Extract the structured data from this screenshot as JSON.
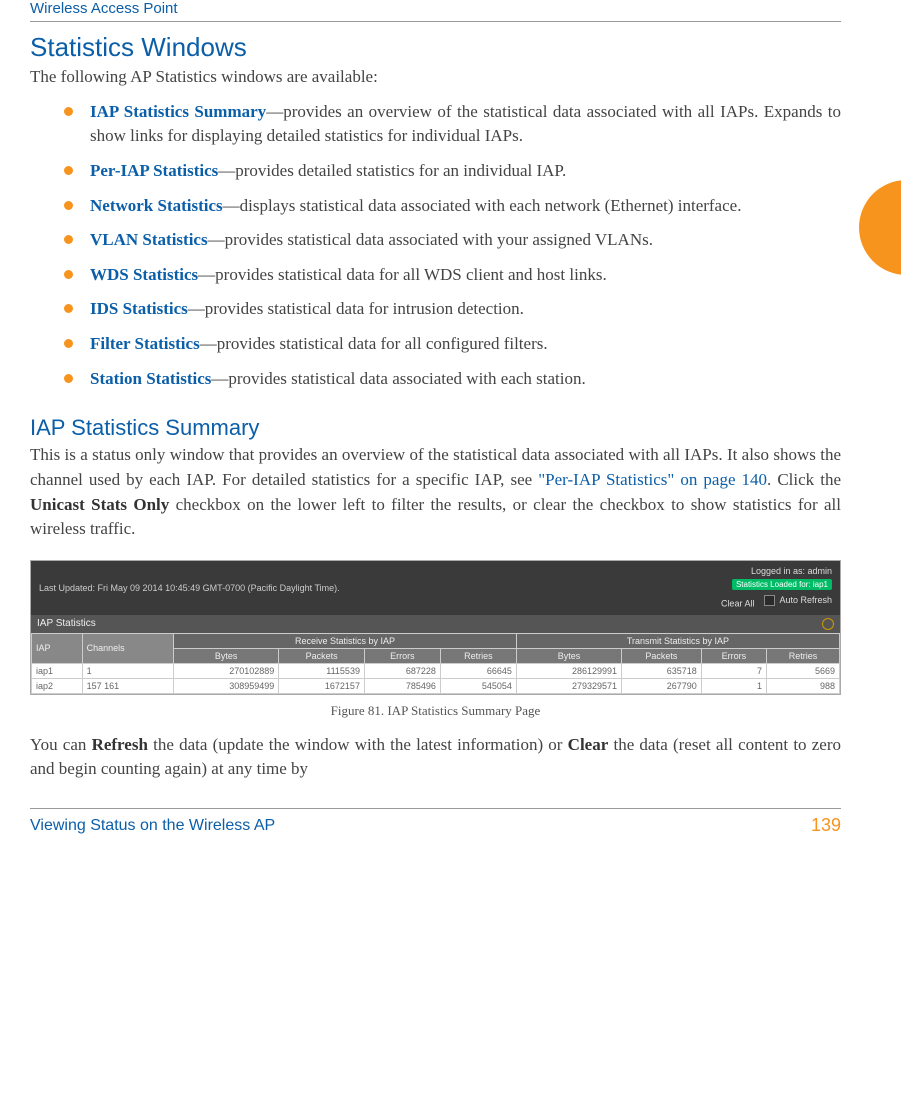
{
  "header": {
    "product": "Wireless Access Point"
  },
  "section_title": "Statistics Windows",
  "intro": "The following AP Statistics windows are available:",
  "bullets": [
    {
      "term": "IAP Statistics Summary",
      "rest": "—provides an overview of the statistical data associated with all IAPs. Expands to show links for displaying detailed statistics for individual IAPs."
    },
    {
      "term": "Per-IAP Statistics",
      "rest": "—provides detailed statistics for an individual IAP."
    },
    {
      "term": "Network Statistics",
      "rest": "—displays statistical data associated with each network (Ethernet) interface."
    },
    {
      "term": "VLAN Statistics",
      "rest": "—provides statistical data associated with your assigned VLANs."
    },
    {
      "term": "WDS Statistics",
      "rest": "—provides statistical data for all WDS client and host links."
    },
    {
      "term": "IDS Statistics",
      "rest": "—provides statistical data for intrusion detection."
    },
    {
      "term": "Filter Statistics",
      "rest": "—provides statistical data for all configured filters."
    },
    {
      "term": "Station Statistics",
      "rest": "—provides statistical data associated with each station."
    }
  ],
  "subsection_title": "IAP Statistics Summary",
  "para2_a": "This is a status only window that provides an overview of the statistical data associated with all IAPs. It also shows the channel used by each IAP. For detailed statistics for a specific IAP, see ",
  "para2_link": "\"Per-IAP Statistics\" on page 140",
  "para2_b": ". Click the ",
  "para2_bold1": "Unicast Stats Only",
  "para2_c": " checkbox on the lower left to filter the results, or clear the checkbox to show statistics for all wireless traffic.",
  "figure": {
    "topbar_left": "Last Updated: Fri May 09 2014 10:45:49 GMT-0700 (Pacific Daylight Time).",
    "logged": "Logged in as: admin",
    "loaded": "Statistics Loaded for: iap1",
    "clear_all": "Clear All",
    "auto_refresh": "Auto Refresh",
    "section_label": "IAP Statistics",
    "group_rx": "Receive Statistics by IAP",
    "group_tx": "Transmit Statistics by IAP",
    "cols": {
      "iap": "IAP",
      "ch": "Channels",
      "bytes": "Bytes",
      "packets": "Packets",
      "errors": "Errors",
      "retries": "Retries"
    },
    "rows": [
      {
        "iap": "iap1",
        "ch": "1",
        "rb": "270102889",
        "rp": "1115539",
        "re": "687228",
        "rr": "66645",
        "tb": "286129991",
        "tp": "635718",
        "te": "7",
        "tr": "5669"
      },
      {
        "iap": "iap2",
        "ch": "157 161",
        "rb": "308959499",
        "rp": "1672157",
        "re": "785496",
        "rr": "545054",
        "tb": "279329571",
        "tp": "267790",
        "te": "1",
        "tr": "988"
      }
    ]
  },
  "fig_caption": "Figure 81. IAP Statistics Summary Page",
  "para3_a": "You can ",
  "para3_bold1": "Refresh",
  "para3_b": " the data (update the window with the latest information) or ",
  "para3_bold2": "Clear",
  "para3_c": " the data (reset all content to zero and begin counting again) at any time by",
  "footer": {
    "left": "Viewing Status on the Wireless AP",
    "page": "139"
  }
}
